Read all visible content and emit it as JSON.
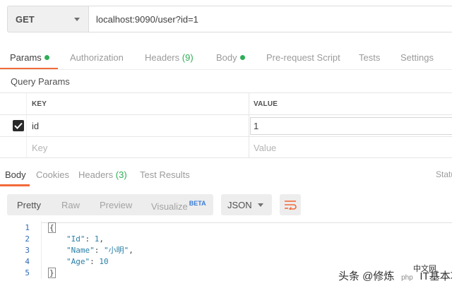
{
  "request": {
    "method": "GET",
    "url": "localhost:9090/user?id=1"
  },
  "request_tabs": [
    {
      "label": "Params",
      "dot": true
    },
    {
      "label": "Authorization"
    },
    {
      "label": "Headers",
      "count": "(9)"
    },
    {
      "label": "Body",
      "dot": true
    },
    {
      "label": "Pre-request Script"
    },
    {
      "label": "Tests"
    },
    {
      "label": "Settings"
    }
  ],
  "query_params": {
    "title": "Query Params",
    "headers": {
      "key": "KEY",
      "value": "VALUE"
    },
    "rows": [
      {
        "key": "id",
        "value": "1",
        "checked": true
      }
    ],
    "placeholder": {
      "key": "Key",
      "value": "Value"
    }
  },
  "response_tabs": [
    {
      "label": "Body"
    },
    {
      "label": "Cookies"
    },
    {
      "label": "Headers",
      "count": "(3)"
    },
    {
      "label": "Test Results"
    }
  ],
  "status_label": "Statu",
  "view_modes": [
    {
      "label": "Pretty"
    },
    {
      "label": "Raw"
    },
    {
      "label": "Preview"
    },
    {
      "label": "Visualize",
      "badge": "BETA"
    }
  ],
  "format": "JSON",
  "code": {
    "line_numbers": [
      "1",
      "2",
      "3",
      "4",
      "5"
    ],
    "open_brace": "{",
    "close_brace": "}",
    "fields": [
      {
        "key": "\"Id\"",
        "value": "1",
        "suffix": ","
      },
      {
        "key": "\"Name\"",
        "value": "\"小明\"",
        "suffix": ","
      },
      {
        "key": "\"Age\"",
        "value": "10",
        "suffix": ""
      }
    ]
  },
  "watermark": {
    "left": "头条 @修炼",
    "right": "IT基本功",
    "logo_text": "php",
    "logo_suffix": "中文网"
  },
  "colors": {
    "accent": "#f26b3a",
    "green": "#2eae56",
    "beta": "#3a7bd5"
  }
}
